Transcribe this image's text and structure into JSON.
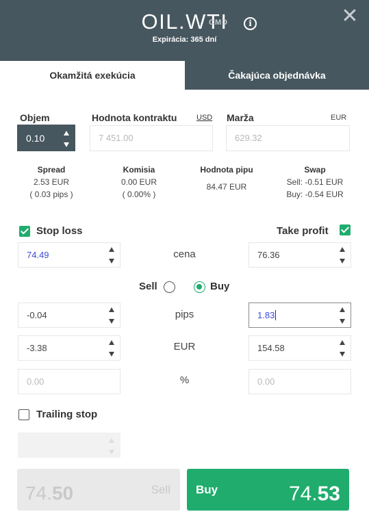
{
  "header": {
    "symbol": "OIL.WTI",
    "type_badge": "CMD",
    "expiry": "Expirácia: 365 dní",
    "info_icon": "info-icon",
    "close_icon": "close-icon"
  },
  "tabs": [
    {
      "label": "Okamžitá exekúcia",
      "active": true
    },
    {
      "label": "Čakajúca objednávka",
      "active": false
    }
  ],
  "volume": {
    "label": "Objem",
    "value": "0.10"
  },
  "contract_value": {
    "label": "Hodnota kontraktu",
    "currency": "USD",
    "value": "7 451.00"
  },
  "margin": {
    "label": "Marža",
    "currency": "EUR",
    "value": "629.32"
  },
  "stats": {
    "spread": {
      "label": "Spread",
      "line1": "2.53 EUR",
      "line2": "( 0.03 pips )"
    },
    "commission": {
      "label": "Komisia",
      "line1": "0.00 EUR",
      "line2": "( 0.00% )"
    },
    "pip_value": {
      "label": "Hodnota pipu",
      "line1": "84.47 EUR"
    },
    "swap": {
      "label": "Swap",
      "line1": "Sell: -0.51 EUR",
      "line2": "Buy: -0.54 EUR"
    }
  },
  "stop_loss": {
    "label": "Stop loss",
    "checked": true,
    "price": "74.49",
    "pips": "-0.04",
    "eur": "-3.38",
    "percent": "0.00"
  },
  "take_profit": {
    "label": "Take profit",
    "checked": true,
    "price": "76.36",
    "pips": "1.83",
    "eur": "154.58",
    "percent": "0.00"
  },
  "row_labels": {
    "price": "cena",
    "pips": "pips",
    "eur": "EUR",
    "percent": "%"
  },
  "side": {
    "sell_label": "Sell",
    "buy_label": "Buy",
    "selected": "Buy"
  },
  "trailing_stop": {
    "label": "Trailing stop",
    "checked": false
  },
  "sell_button": {
    "label": "Sell",
    "price_int": "74.",
    "price_frac": "50"
  },
  "buy_button": {
    "label": "Buy",
    "price_int": "74.",
    "price_frac": "53"
  },
  "colors": {
    "header_bg": "#47575f",
    "accent_green": "#1fac6d",
    "link_blue": "#3b4bd8"
  }
}
